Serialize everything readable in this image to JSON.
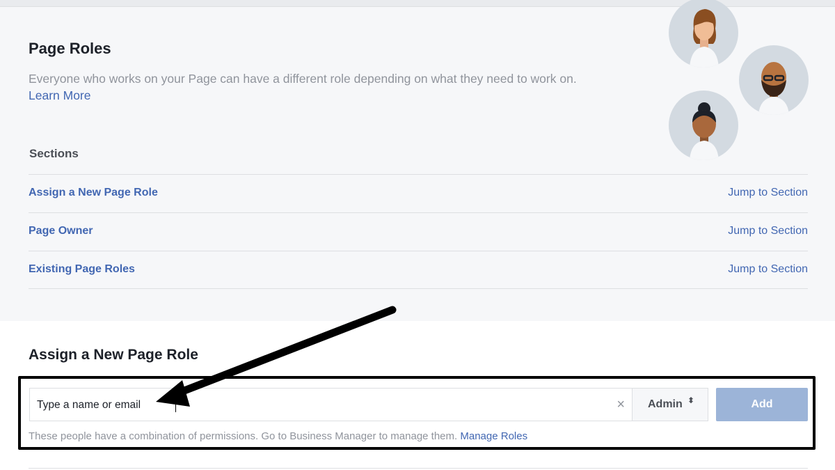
{
  "header": {
    "title": "Page Roles",
    "description": "Everyone who works on your Page can have a different role depending on what they need to work on.",
    "learn_more": "Learn More"
  },
  "sections": {
    "heading": "Sections",
    "items": [
      {
        "label": "Assign a New Page Role",
        "jump": "Jump to Section"
      },
      {
        "label": "Page Owner",
        "jump": "Jump to Section"
      },
      {
        "label": "Existing Page Roles",
        "jump": "Jump to Section"
      }
    ]
  },
  "assign": {
    "title": "Assign a New Page Role",
    "input_placeholder": "Type a name or email",
    "clear_icon": "×",
    "role_value": "Admin",
    "role_caret": "⬍",
    "add_label": "Add",
    "note_text": "These people have a combination of permissions. Go to Business Manager to manage them.",
    "manage_roles": "Manage Roles"
  },
  "colors": {
    "link": "#4267b2",
    "panel_bg": "#f6f7f9",
    "add_button": "#9cb4d8",
    "avatar_bg": "#d3dae1"
  },
  "icons": [
    "woman-avatar-icon",
    "bearded-man-avatar-icon",
    "woman-bun-avatar-icon",
    "clear-icon",
    "sort-caret-icon",
    "pointer-arrow"
  ]
}
